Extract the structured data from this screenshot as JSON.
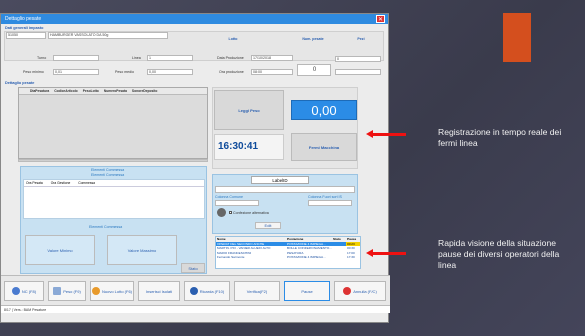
{
  "window": {
    "title": "Dettaglio pesate"
  },
  "header": {
    "section_label": "Dati generali impasto",
    "code": "51050",
    "description": "HAMBURGER VASSOLATO DA 50g",
    "col_headers": [
      "Lotto",
      "Num. pesate",
      "Pezi"
    ]
  },
  "form": {
    "turno_label": "Turno",
    "linea_label": "Linea",
    "linea_value": "1",
    "data_prod_label": "Data Produzione",
    "data_prod_value": "17/10/2018",
    "counter_value": "0",
    "counter2_value": "0",
    "peso_min_label": "Peso minimo",
    "peso_min_value": "0,01",
    "peso_med_label": "Peso medio",
    "peso_med_value": "0,00",
    "ora_prod_label": "Ora produzione",
    "ora_prod_value": "08:00"
  },
  "detail": {
    "title": "Dettaglio pesate",
    "columns": [
      "DtaPesatura",
      "CodiceArticolo",
      "PesoLotto",
      "NumeroPesata",
      "SonoreDeposito",
      "Gen. Ordinato",
      "Attivita"
    ]
  },
  "right_panel": {
    "leggi_peso": "Leggi Peso",
    "weight": "0,00",
    "clock": "16:30:41",
    "fermi_macchina": "Fermi Macchina"
  },
  "fermi": {
    "title": "Elementi Commessa",
    "subtitle": "Elementi Commessa",
    "columns": [
      "Ora Pesata",
      "Ora Gestione",
      "Commessa"
    ],
    "footer": "Elementi Commessa",
    "valore_minimo": "Valore Minimo",
    "valore_massimo": "Valore Massimo",
    "stato": "Stato"
  },
  "label_panel": {
    "title": "LabelID",
    "field1": "Colonna Comune",
    "field2": "Colonna Fuori sort IS",
    "check_label": "Confezione alternativa",
    "button": "Edit"
  },
  "pause_table": {
    "headers": [
      "Nome",
      "Postazione",
      "Stato",
      "Pausa"
    ],
    "rows": [
      {
        "nome": "OPERAT DEL SECONDO ANCHE",
        "post": "POSTAZIONE 4 IMPIEGA...",
        "stato": "",
        "pausa": "00:23"
      },
      {
        "nome": "MARTIN. PIO - VANIER ALUEIO ALTO",
        "post": "BOLLE CONFEZIONAMENTO...",
        "stato": "",
        "pausa": "00:30"
      },
      {
        "nome": "MARIO FRANCESCHINI",
        "post": "PESATURA",
        "stato": "",
        "pausa": "17:00"
      },
      {
        "nome": "Fernando Sarmonte",
        "post": "POSTAZIONE 4 IMPIEGA...",
        "stato": "",
        "pausa": "17:30"
      }
    ]
  },
  "toolbar": {
    "b1": "NC (F8)",
    "b2": "Peso (F9)",
    "b3": "Nuovo Lotto (F6)",
    "b4": "Inserisci Isolati",
    "b5": "Ricarda (F10)",
    "b6": "Verifica(F2)",
    "b7": "Pause",
    "b8": "Annulla (F/C)"
  },
  "statusbar": {
    "text": "8/17 | Vers.: BAM Pesature"
  },
  "annotations": {
    "a1": "Registrazione in tempo reale dei fermi linea",
    "a2": "Rapida visione della situazione pause dei diversi operatori della linea"
  },
  "colors": {
    "accent_blue": "#2b8ce6",
    "orange": "#d44f1e",
    "arrow_red": "#e11111"
  }
}
